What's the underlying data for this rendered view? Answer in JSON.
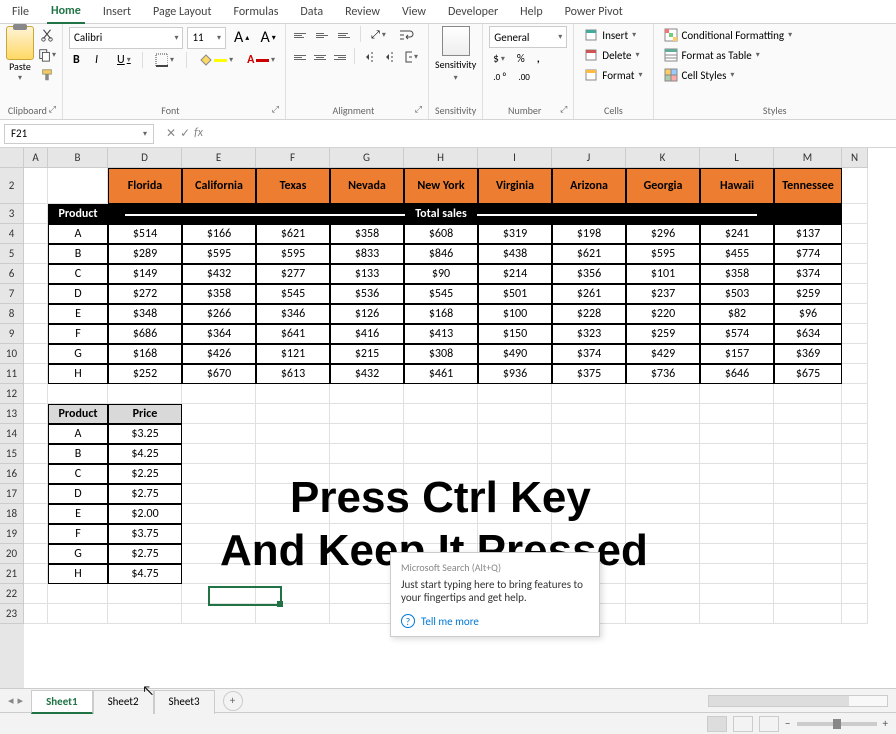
{
  "ribbon_tabs": [
    "File",
    "Home",
    "Insert",
    "Page Layout",
    "Formulas",
    "Data",
    "Review",
    "View",
    "Developer",
    "Help",
    "Power Pivot"
  ],
  "active_tab": "Home",
  "clipboard": {
    "paste": "Paste",
    "label": "Clipboard"
  },
  "font": {
    "name": "Calibri",
    "size": "11",
    "label": "Font"
  },
  "alignment": {
    "label": "Alignment"
  },
  "sensitivity": {
    "btn": "Sensitivity",
    "label": "Sensitivity"
  },
  "number": {
    "format": "General",
    "label": "Number"
  },
  "cells": {
    "insert": "Insert",
    "delete": "Delete",
    "format": "Format",
    "label": "Cells"
  },
  "styles": {
    "cond": "Conditional Formatting",
    "table": "Format as Table",
    "cell": "Cell Styles",
    "label": "Styles"
  },
  "name_box": "F21",
  "columns": [
    "A",
    "B",
    "D",
    "E",
    "F",
    "G",
    "H",
    "I",
    "J",
    "K",
    "L",
    "M",
    "N"
  ],
  "column_widths": {
    "A": 24,
    "B": 60,
    "D": 74,
    "E": 74,
    "F": 74,
    "G": 74,
    "H": 74,
    "I": 74,
    "J": 74,
    "K": 74,
    "L": 74,
    "M": 68,
    "N": 26
  },
  "row_labels": [
    "2",
    "3",
    "4",
    "5",
    "6",
    "7",
    "8",
    "9",
    "10",
    "11",
    "12",
    "13",
    "14",
    "15",
    "16",
    "17",
    "18",
    "19",
    "20",
    "21",
    "22",
    "23"
  ],
  "states": [
    "Florida",
    "California",
    "Texas",
    "Nevada",
    "New York",
    "Virginia",
    "Arizona",
    "Georgia",
    "Hawaii",
    "Tennessee"
  ],
  "product_header": "Product",
  "total_sales": "Total sales",
  "products": [
    "A",
    "B",
    "C",
    "D",
    "E",
    "F",
    "G",
    "H"
  ],
  "sales": [
    [
      "$514",
      "$166",
      "$621",
      "$358",
      "$608",
      "$319",
      "$198",
      "$296",
      "$241",
      "$137"
    ],
    [
      "$289",
      "$595",
      "$595",
      "$833",
      "$846",
      "$438",
      "$621",
      "$595",
      "$455",
      "$774"
    ],
    [
      "$149",
      "$432",
      "$277",
      "$133",
      "$90",
      "$214",
      "$356",
      "$101",
      "$358",
      "$374"
    ],
    [
      "$272",
      "$358",
      "$545",
      "$536",
      "$545",
      "$501",
      "$261",
      "$237",
      "$503",
      "$259"
    ],
    [
      "$348",
      "$266",
      "$346",
      "$126",
      "$168",
      "$100",
      "$228",
      "$220",
      "$82",
      "$96"
    ],
    [
      "$686",
      "$364",
      "$641",
      "$416",
      "$413",
      "$150",
      "$323",
      "$259",
      "$574",
      "$634"
    ],
    [
      "$168",
      "$426",
      "$121",
      "$215",
      "$308",
      "$490",
      "$374",
      "$429",
      "$157",
      "$369"
    ],
    [
      "$252",
      "$670",
      "$613",
      "$432",
      "$461",
      "$936",
      "$375",
      "$736",
      "$646",
      "$675"
    ]
  ],
  "price_header": {
    "product": "Product",
    "price": "Price"
  },
  "prices": [
    [
      "A",
      "$3.25"
    ],
    [
      "B",
      "$4.25"
    ],
    [
      "C",
      "$2.25"
    ],
    [
      "D",
      "$2.75"
    ],
    [
      "E",
      "$2.00"
    ],
    [
      "F",
      "$3.75"
    ],
    [
      "G",
      "$2.75"
    ],
    [
      "H",
      "$4.75"
    ]
  ],
  "overlay": {
    "line1": "Press Ctrl Key",
    "line2": "And Keep It Pressed"
  },
  "tooltip": {
    "title_hint": "Alt+Q",
    "body": "Just start typing here to bring features to your fingertips and get help.",
    "link": "Tell me more"
  },
  "sheet_tabs": [
    "Sheet1",
    "Sheet2",
    "Sheet3"
  ],
  "active_sheet": "Sheet1"
}
